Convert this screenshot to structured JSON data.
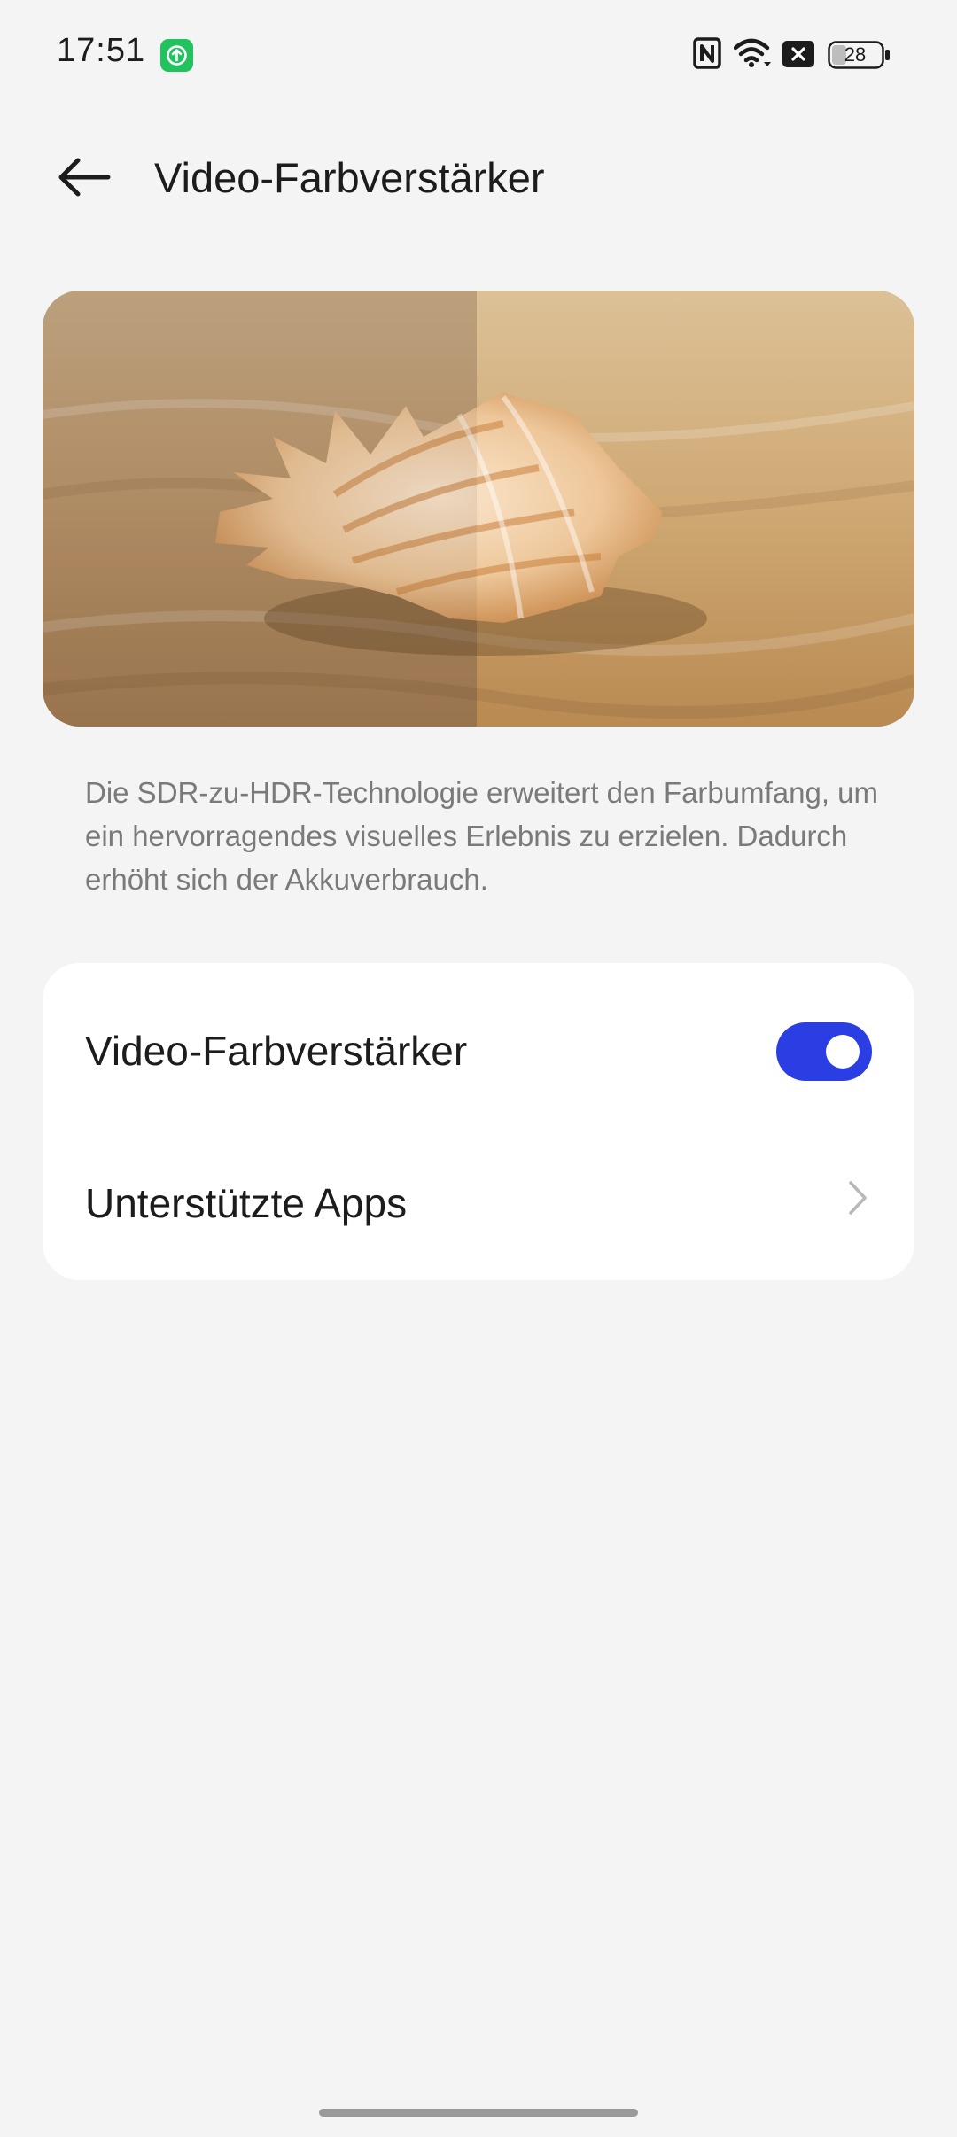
{
  "status_bar": {
    "time": "17:51",
    "app_icon": "upload-arrow-icon",
    "icons": [
      "nfc-icon",
      "wifi-icon",
      "close-box-icon",
      "battery-icon"
    ],
    "battery_level": "28",
    "accent_color": "#22c35e"
  },
  "header": {
    "back_icon": "arrow-left-icon",
    "title": "Video-Farbverstärker"
  },
  "description": "Die SDR-zu-HDR-Technologie erweitert den Farbumfang, um ein hervorragendes visuelles Erlebnis zu erzielen. Dadurch erhöht sich der Akkuverbrauch.",
  "settings": {
    "items": [
      {
        "label": "Video-Farbverstärker",
        "control": "toggle",
        "enabled": true
      },
      {
        "label": "Unterstützte Apps",
        "control": "chevron-right-icon"
      }
    ],
    "toggle_color": "#2b3ee3"
  }
}
